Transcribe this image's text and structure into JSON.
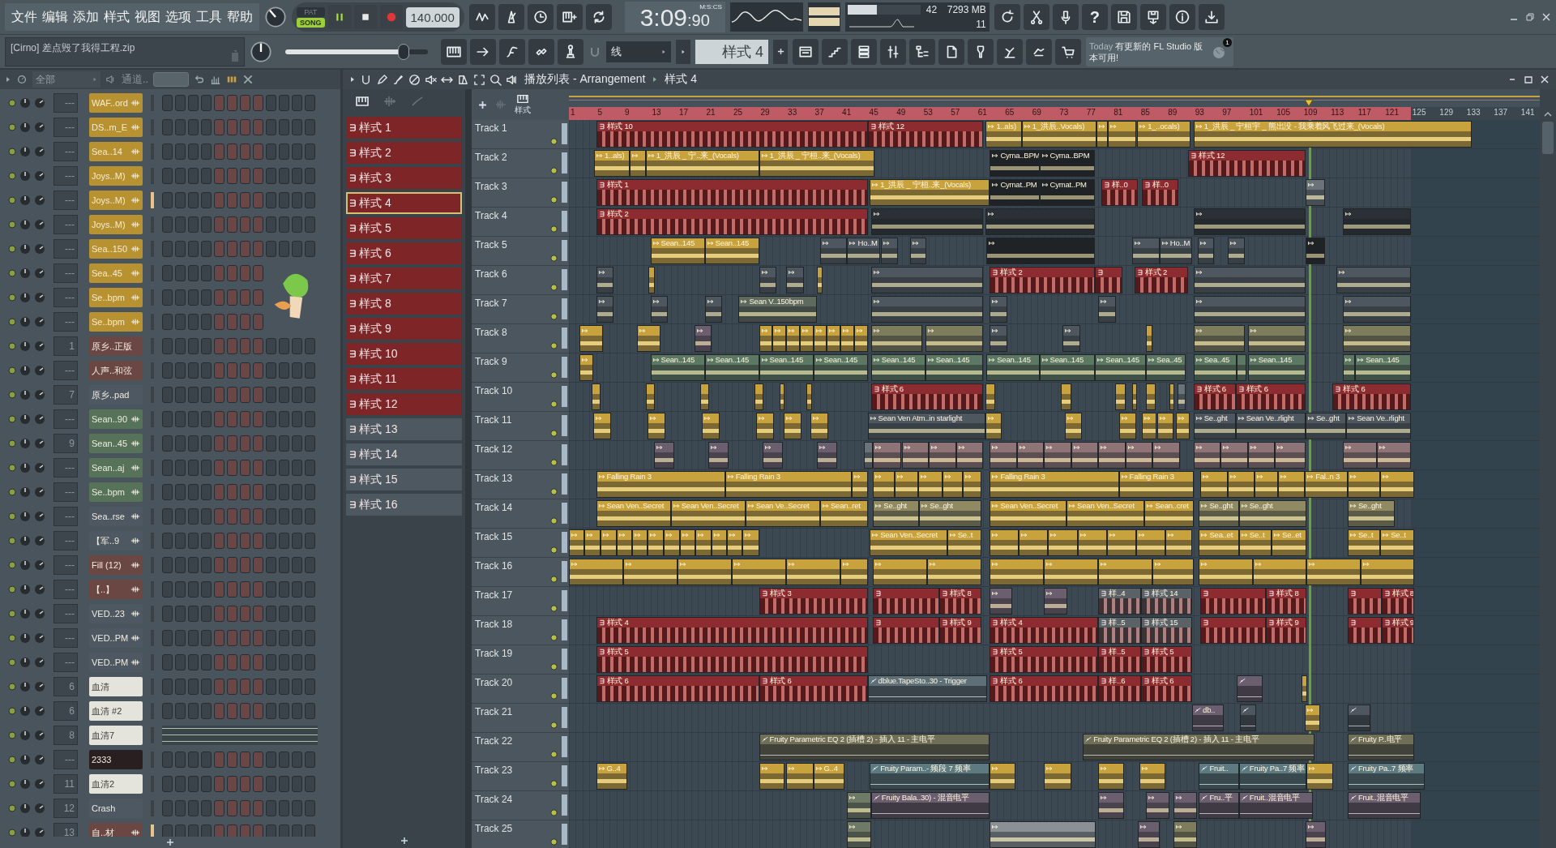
{
  "menu": [
    "文件",
    "编辑",
    "添加",
    "样式",
    "视图",
    "选项",
    "工具",
    "帮助"
  ],
  "transport": {
    "modes": [
      {
        "label": "PAT",
        "selected": false
      },
      {
        "label": "SONG",
        "selected": true
      }
    ],
    "playing": true,
    "tempo": "140.000",
    "time_main": "3:09",
    "time_cs": ":90",
    "time_format": "M:S:CS"
  },
  "monitor": {
    "level": 0.4,
    "cpu": "42",
    "memory": "7293 MB",
    "polyphony": "11"
  },
  "help": "?",
  "hint": "[Cirno] 差点毁了我得工程.zip",
  "master_slider": {
    "level": 0.83
  },
  "snap": "线",
  "pattern_selector": "样式 4",
  "news": {
    "day": "Today",
    "text": "有更新的 FL Studio 版本可用!",
    "badge": "1"
  },
  "channel_rack": {
    "filter": "全部",
    "title": "通道..",
    "channels": [
      {
        "name": "WAF..ord",
        "mixer": "---",
        "kind": "audio",
        "color": "#b89230",
        "selected": false
      },
      {
        "name": "DS..m_E",
        "mixer": "---",
        "kind": "audio",
        "color": "#b89230",
        "selected": false
      },
      {
        "name": "Sea..14",
        "mixer": "---",
        "kind": "audio",
        "color": "#b89230",
        "selected": false
      },
      {
        "name": "Joys..M)",
        "mixer": "---",
        "kind": "audio",
        "color": "#b89230",
        "selected": false
      },
      {
        "name": "Joys..M)",
        "mixer": "---",
        "kind": "audio",
        "color": "#b89230",
        "selected": true
      },
      {
        "name": "Joys..M)",
        "mixer": "---",
        "kind": "audio",
        "color": "#b89230",
        "selected": false
      },
      {
        "name": "Sea..150",
        "mixer": "---",
        "kind": "audio",
        "color": "#b89230",
        "selected": false
      },
      {
        "name": "Sea..45",
        "mixer": "---",
        "kind": "audio",
        "color": "#b89230",
        "selected": false
      },
      {
        "name": "Se..bpm",
        "mixer": "---",
        "kind": "audio",
        "color": "#b89230",
        "selected": false
      },
      {
        "name": "Se..bpm",
        "mixer": "---",
        "kind": "audio",
        "color": "#b89230",
        "selected": false
      },
      {
        "name": "原乡..正版",
        "mixer": "1",
        "kind": "instrument",
        "color": "#6b4744",
        "selected": false
      },
      {
        "name": "人声..和弦",
        "mixer": "---",
        "kind": "instrument",
        "color": "#6b4744",
        "selected": false
      },
      {
        "name": "原乡..pad",
        "mixer": "7",
        "kind": "instrument",
        "color": "#4d5862",
        "selected": false
      },
      {
        "name": "Sean..90",
        "mixer": "---",
        "kind": "audio",
        "color": "#56735a",
        "selected": false
      },
      {
        "name": "Sean..45",
        "mixer": "9",
        "kind": "audio",
        "color": "#56735a",
        "selected": false
      },
      {
        "name": "Sean..aj",
        "mixer": "---",
        "kind": "audio",
        "color": "#56735a",
        "selected": false
      },
      {
        "name": "Se..bpm",
        "mixer": "---",
        "kind": "audio",
        "color": "#56735a",
        "selected": false
      },
      {
        "name": "Sea..rse",
        "mixer": "---",
        "kind": "audio",
        "color": "#4d5862",
        "selected": false
      },
      {
        "name": "【军..9",
        "mixer": "---",
        "kind": "audio",
        "color": "#4d5862",
        "selected": false
      },
      {
        "name": "Fill (12)",
        "mixer": "---",
        "kind": "audio",
        "color": "#6b4744",
        "selected": false
      },
      {
        "name": "【..】",
        "mixer": "---",
        "kind": "audio",
        "color": "#6b4744",
        "selected": false
      },
      {
        "name": "VED..23",
        "mixer": "---",
        "kind": "audio",
        "color": "#4d5862",
        "selected": false
      },
      {
        "name": "VED..PM",
        "mixer": "---",
        "kind": "audio",
        "color": "#4d5862",
        "selected": false
      },
      {
        "name": "VED..PM",
        "mixer": "---",
        "kind": "audio",
        "color": "#4d5862",
        "selected": false
      },
      {
        "name": "血清",
        "mixer": "6",
        "kind": "instrument",
        "color": "#e4e4dc",
        "selected": false
      },
      {
        "name": "血清 #2",
        "mixer": "6",
        "kind": "instrument",
        "color": "#e4e4dc",
        "selected": false
      },
      {
        "name": "血清7",
        "mixer": "8",
        "kind": "pianoroll",
        "color": "#e4e4dc",
        "selected": false
      },
      {
        "name": "2333",
        "mixer": "---",
        "kind": "instrument",
        "color": "#2a1f20",
        "selected": false
      },
      {
        "name": "血清2",
        "mixer": "11",
        "kind": "instrument",
        "color": "#e4e4dc",
        "selected": false
      },
      {
        "name": "Crash",
        "mixer": "12",
        "kind": "instrument",
        "color": "#4d5862",
        "selected": false
      },
      {
        "name": "自..材",
        "mixer": "13",
        "kind": "audio",
        "color": "#6b4744",
        "selected": true
      }
    ]
  },
  "patterns": [
    {
      "name": "样式 1",
      "selected": false,
      "color": "#7e2528"
    },
    {
      "name": "样式 2",
      "selected": false,
      "color": "#7e2528"
    },
    {
      "name": "样式 3",
      "selected": false,
      "color": "#7e2528"
    },
    {
      "name": "样式 4",
      "selected": true,
      "color": "#7e2528"
    },
    {
      "name": "样式 5",
      "selected": false,
      "color": "#7e2528"
    },
    {
      "name": "样式 6",
      "selected": false,
      "color": "#7e2528"
    },
    {
      "name": "样式 7",
      "selected": false,
      "color": "#7e2528"
    },
    {
      "name": "样式 8",
      "selected": false,
      "color": "#7e2528"
    },
    {
      "name": "样式 9",
      "selected": false,
      "color": "#7e2528"
    },
    {
      "name": "样式 10",
      "selected": false,
      "color": "#7e2528"
    },
    {
      "name": "样式 11",
      "selected": false,
      "color": "#7e2528"
    },
    {
      "name": "样式 12",
      "selected": false,
      "color": "#7e2528"
    },
    {
      "name": "样式 13",
      "selected": false,
      "color": "#4e5860"
    },
    {
      "name": "样式 14",
      "selected": false,
      "color": "#4e5860"
    },
    {
      "name": "样式 15",
      "selected": false,
      "color": "#4e5860"
    },
    {
      "name": "样式 16",
      "selected": false,
      "color": "#4e5860"
    }
  ],
  "playlist": {
    "title": "播放列表 - Arrangement",
    "pattern": "样式 4",
    "tab": "样式",
    "ruler": [
      "1",
      "5",
      "9",
      "13",
      "17",
      "21",
      "25",
      "29",
      "33",
      "37",
      "41",
      "45",
      "49",
      "53",
      "57",
      "61",
      "65",
      "69",
      "73",
      "77",
      "81",
      "85",
      "89",
      "93",
      "97",
      "101",
      "105",
      "109",
      "113",
      "117",
      "121",
      "125",
      "129",
      "133",
      "137",
      "141"
    ],
    "tracks": [
      {
        "name": "Track 1",
        "clips": [
          {
            "kind": "pattern",
            "name": "样式 10",
            "color": "#8c2c30"
          },
          {
            "kind": "pattern",
            "name": "样式 12",
            "color": "#8c2c30"
          },
          {
            "kind": "audio",
            "name": "1..als)",
            "color": "#c8a23c"
          },
          {
            "kind": "audio",
            "name": "1_洪辰..Vocals)",
            "color": "#c8a23c"
          },
          {
            "kind": "audio",
            "color": "#c8a23c"
          },
          {
            "kind": "audio",
            "color": "#c8a23c"
          },
          {
            "kind": "audio",
            "name": "1_..ocals)",
            "color": "#c8a23c"
          },
          {
            "kind": "audio",
            "name": "1_洪辰 _ 宁桓宇 _ 熊出没 - 我乘着风飞过来_(Vocals)",
            "color": "#c8a23c"
          }
        ]
      },
      {
        "name": "Track 2",
        "clips": [
          {
            "kind": "audio",
            "name": "1..als)",
            "color": "#c8a23c"
          },
          {
            "kind": "audio",
            "color": "#c8a23c"
          },
          {
            "kind": "audio",
            "name": "1_洪辰 _ 宁..来_(Vocals)",
            "color": "#c8a23c"
          },
          {
            "kind": "audio",
            "name": "1_洪辰 _ 宁桓..来_(Vocals)",
            "color": "#c8a23c"
          },
          {
            "kind": "audio",
            "name": "Cyma..BPM",
            "color": "#1f2326"
          },
          {
            "kind": "audio",
            "name": "Cyma..BPM",
            "color": "#1f2326"
          },
          {
            "kind": "pattern",
            "name": "样式 12",
            "color": "#8c2c30"
          }
        ]
      },
      {
        "name": "Track 3",
        "clips": [
          {
            "kind": "pattern",
            "name": "样式 1",
            "color": "#8c2c30"
          },
          {
            "kind": "audio",
            "name": "1_洪辰 _ 宁桓..来_(Vocals)",
            "color": "#c8a23c"
          },
          {
            "kind": "audio",
            "name": "Cymat..PM",
            "color": "#1f2326"
          },
          {
            "kind": "audio",
            "name": "Cymat..PM",
            "color": "#1f2326"
          },
          {
            "kind": "pattern",
            "name": "样..0",
            "color": "#8c2c30"
          },
          {
            "kind": "pattern",
            "name": "样..0",
            "color": "#8c2c30"
          },
          {
            "kind": "audio",
            "color": "#6a737a"
          }
        ]
      },
      {
        "name": "Track 4",
        "clips": [
          {
            "kind": "pattern",
            "name": "样式 2",
            "color": "#8c2c30"
          },
          {
            "kind": "audio",
            "color": "#2a3036"
          },
          {
            "kind": "audio",
            "color": "#2a3036"
          },
          {
            "kind": "audio",
            "color": "#2a3036"
          },
          {
            "kind": "audio",
            "color": "#2a3036"
          }
        ]
      },
      {
        "name": "Track 5",
        "clips": [
          {
            "kind": "audio",
            "name": "Sean..145",
            "color": "#c8a23c"
          },
          {
            "kind": "audio",
            "name": "Sean..145",
            "color": "#c8a23c"
          },
          {
            "kind": "audio",
            "color": "#4e575f"
          },
          {
            "kind": "audio",
            "name": "Ho..M",
            "color": "#4e575f"
          },
          {
            "kind": "audio",
            "color": "#4e575f"
          },
          {
            "kind": "audio",
            "color": "#4e575f"
          },
          {
            "kind": "audio",
            "color": "#1f2326"
          },
          {
            "kind": "audio",
            "color": "#4e575f"
          },
          {
            "kind": "audio",
            "name": "Ho..M",
            "color": "#4e575f"
          },
          {
            "kind": "audio",
            "color": "#4e575f"
          },
          {
            "kind": "audio",
            "color": "#4e575f"
          },
          {
            "kind": "audio",
            "color": "#1f2326"
          }
        ]
      },
      {
        "name": "Track 6",
        "clips": [
          {
            "kind": "audio",
            "color": "#4e575f"
          },
          {
            "kind": "audio",
            "color": "#c8a23c"
          },
          {
            "kind": "audio",
            "color": "#4e575f"
          },
          {
            "kind": "audio",
            "color": "#4e575f"
          },
          {
            "kind": "audio",
            "color": "#c8a23c"
          },
          {
            "kind": "audio",
            "color": "#4e575f"
          },
          {
            "kind": "pattern",
            "name": "样式 2",
            "color": "#8c2c30"
          },
          {
            "kind": "pattern",
            "color": "#8c2c30"
          },
          {
            "kind": "pattern",
            "name": "样式 2",
            "color": "#8c2c30"
          },
          {
            "kind": "audio",
            "color": "#4e575f"
          },
          {
            "kind": "audio",
            "color": "#4e575f"
          }
        ]
      },
      {
        "name": "Track 7",
        "clips": [
          {
            "kind": "audio",
            "color": "#4e575f"
          },
          {
            "kind": "audio",
            "color": "#4e575f"
          },
          {
            "kind": "audio",
            "color": "#4e575f"
          },
          {
            "kind": "audio",
            "name": "Sean V..150bpm",
            "color": "#5f6a5e"
          },
          {
            "kind": "audio",
            "color": "#4e575f"
          },
          {
            "kind": "audio",
            "color": "#4e575f"
          },
          {
            "kind": "audio",
            "color": "#4e575f"
          },
          {
            "kind": "audio",
            "color": "#4e575f"
          },
          {
            "kind": "audio",
            "color": "#4e575f"
          }
        ]
      },
      {
        "name": "Track 8",
        "clips": [
          {
            "kind": "audio",
            "color": "#c8a23c"
          },
          {
            "kind": "audio",
            "color": "#c8a23c"
          },
          {
            "kind": "audio",
            "color": "#6b5e6e"
          },
          {
            "kind": "audio",
            "color": "#c8a23c"
          },
          {
            "kind": "audio",
            "color": "#c8a23c"
          },
          {
            "kind": "audio",
            "color": "#c8a23c"
          },
          {
            "kind": "audio",
            "color": "#c8a23c"
          },
          {
            "kind": "audio",
            "color": "#c8a23c"
          },
          {
            "kind": "audio",
            "color": "#c8a23c"
          },
          {
            "kind": "audio",
            "color": "#c8a23c"
          },
          {
            "kind": "audio",
            "color": "#c8a23c"
          },
          {
            "kind": "audio",
            "color": "#7d7c5c"
          },
          {
            "kind": "audio",
            "color": "#7d7c5c"
          },
          {
            "kind": "audio",
            "color": "#4e575f"
          },
          {
            "kind": "audio",
            "color": "#4e575f"
          },
          {
            "kind": "audio",
            "color": "#c8a23c"
          },
          {
            "kind": "audio",
            "color": "#7d7c5c"
          },
          {
            "kind": "audio",
            "color": "#7d7c5c"
          },
          {
            "kind": "audio",
            "color": "#7d7c5c"
          }
        ]
      },
      {
        "name": "Track 9",
        "clips": [
          {
            "kind": "audio",
            "color": "#c8a23c"
          },
          {
            "kind": "audio",
            "name": "Sean..145",
            "color": "#5c7862"
          },
          {
            "kind": "audio",
            "name": "Sean..145",
            "color": "#5c7862"
          },
          {
            "kind": "audio",
            "name": "Sean..145",
            "color": "#5c7862"
          },
          {
            "kind": "audio",
            "name": "Sean..145",
            "color": "#5c7862"
          },
          {
            "kind": "audio",
            "name": "Sean..145",
            "color": "#5c7862"
          },
          {
            "kind": "audio",
            "name": "Sean..145",
            "color": "#5c7862"
          },
          {
            "kind": "audio",
            "name": "Sean..145",
            "color": "#5c7862"
          },
          {
            "kind": "audio",
            "name": "Sean..145",
            "color": "#5c7862"
          },
          {
            "kind": "audio",
            "name": "Sean..145",
            "color": "#5c7862"
          },
          {
            "kind": "audio",
            "name": "Sea..45",
            "color": "#5c7862"
          },
          {
            "kind": "audio",
            "name": "Sea..45",
            "color": "#5c7862"
          },
          {
            "kind": "audio",
            "color": "#5c7862"
          },
          {
            "kind": "audio",
            "name": "Sean..145",
            "color": "#5c7862"
          },
          {
            "kind": "audio",
            "color": "#5c7862"
          },
          {
            "kind": "audio",
            "name": "Sean..145",
            "color": "#5c7862"
          }
        ]
      },
      {
        "name": "Track 10",
        "clips": [
          {
            "kind": "audio",
            "color": "#c8a23c"
          },
          {
            "kind": "audio",
            "color": "#c8a23c"
          },
          {
            "kind": "audio",
            "color": "#c8a23c"
          },
          {
            "kind": "audio",
            "color": "#c8a23c"
          },
          {
            "kind": "audio",
            "color": "#c8a23c"
          },
          {
            "kind": "audio",
            "color": "#c8a23c"
          },
          {
            "kind": "pattern",
            "name": "样式 6",
            "color": "#8c2c30"
          },
          {
            "kind": "audio",
            "color": "#c8a23c"
          },
          {
            "kind": "audio",
            "color": "#c8a23c"
          },
          {
            "kind": "audio",
            "color": "#c8a23c"
          },
          {
            "kind": "audio",
            "color": "#c8a23c"
          },
          {
            "kind": "audio",
            "color": "#c8a23c"
          },
          {
            "kind": "audio",
            "color": "#c8a23c"
          },
          {
            "kind": "audio",
            "color": "#6a737a"
          },
          {
            "kind": "pattern",
            "name": "样式 6",
            "color": "#8c2c30"
          },
          {
            "kind": "pattern",
            "name": "样式 6",
            "color": "#8c2c30"
          },
          {
            "kind": "pattern",
            "name": "样式 6",
            "color": "#8c2c30"
          }
        ]
      },
      {
        "name": "Track 11",
        "clips": [
          {
            "kind": "audio",
            "color": "#c8a23c"
          },
          {
            "kind": "audio",
            "color": "#c8a23c"
          },
          {
            "kind": "audio",
            "color": "#c8a23c"
          },
          {
            "kind": "audio",
            "color": "#c8a23c"
          },
          {
            "kind": "audio",
            "color": "#c8a23c"
          },
          {
            "kind": "audio",
            "color": "#c8a23c"
          },
          {
            "kind": "audio",
            "name": "Sean Ven Atm..in starlight",
            "color": "#4e575f"
          },
          {
            "kind": "audio",
            "color": "#c8a23c"
          },
          {
            "kind": "audio",
            "color": "#c8a23c"
          },
          {
            "kind": "audio",
            "color": "#c8a23c"
          },
          {
            "kind": "audio",
            "color": "#c8a23c"
          },
          {
            "kind": "audio",
            "color": "#c8a23c"
          },
          {
            "kind": "audio",
            "color": "#c8a23c"
          },
          {
            "kind": "audio",
            "name": "Se..ght",
            "color": "#4e575f"
          },
          {
            "kind": "audio",
            "name": "Sean Ve..rlight",
            "color": "#4e575f"
          },
          {
            "kind": "audio",
            "name": "Se..ght",
            "color": "#4e575f"
          },
          {
            "kind": "audio",
            "name": "Sean Ve..rlight",
            "color": "#4e575f"
          }
        ]
      },
      {
        "name": "Track 12",
        "clips": [
          {
            "kind": "audio",
            "color": "#6b5e6e"
          },
          {
            "kind": "audio",
            "color": "#6b5e6e"
          },
          {
            "kind": "audio",
            "color": "#6b5e6e"
          },
          {
            "kind": "audio",
            "color": "#6b5e6e"
          },
          {
            "kind": "audio",
            "color": "#6a737a"
          },
          {
            "kind": "audio",
            "color": "#8e7476"
          },
          {
            "kind": "audio",
            "color": "#8e7476"
          },
          {
            "kind": "audio",
            "color": "#8e7476"
          },
          {
            "kind": "audio",
            "color": "#8e7476"
          },
          {
            "kind": "audio",
            "color": "#8e7476"
          },
          {
            "kind": "audio",
            "color": "#8e7476"
          },
          {
            "kind": "audio",
            "color": "#8e7476"
          },
          {
            "kind": "audio",
            "color": "#8e7476"
          },
          {
            "kind": "audio",
            "color": "#8e7476"
          },
          {
            "kind": "audio",
            "color": "#8e7476"
          },
          {
            "kind": "audio",
            "color": "#8e7476"
          },
          {
            "kind": "audio",
            "color": "#8e7476"
          },
          {
            "kind": "audio",
            "color": "#8e7476"
          },
          {
            "kind": "audio",
            "color": "#8e7476"
          },
          {
            "kind": "audio",
            "color": "#8e7476"
          },
          {
            "kind": "audio",
            "color": "#8e7476"
          },
          {
            "kind": "audio",
            "color": "#8e7476"
          }
        ]
      },
      {
        "name": "Track 13",
        "clips": [
          {
            "kind": "audio",
            "name": "Falling Rain 3",
            "color": "#c8a23c"
          },
          {
            "kind": "audio",
            "name": "Falling Rain 3",
            "color": "#c8a23c"
          },
          {
            "kind": "audio",
            "color": "#c8a23c"
          },
          {
            "kind": "audio",
            "color": "#c8a23c"
          },
          {
            "kind": "audio",
            "color": "#c8a23c"
          },
          {
            "kind": "audio",
            "color": "#c8a23c"
          },
          {
            "kind": "audio",
            "color": "#c8a23c"
          },
          {
            "kind": "audio",
            "color": "#c8a23c"
          },
          {
            "kind": "audio",
            "name": "Falling Rain 3",
            "color": "#c8a23c"
          },
          {
            "kind": "audio",
            "name": "Falling Rain 3",
            "color": "#c8a23c"
          },
          {
            "kind": "audio",
            "color": "#c8a23c"
          },
          {
            "kind": "audio",
            "color": "#c8a23c"
          },
          {
            "kind": "audio",
            "color": "#c8a23c"
          },
          {
            "kind": "audio",
            "color": "#c8a23c"
          },
          {
            "kind": "audio",
            "name": "Fal..n 3",
            "color": "#c8a23c"
          },
          {
            "kind": "audio",
            "color": "#c8a23c"
          },
          {
            "kind": "audio",
            "color": "#c8a23c"
          }
        ]
      },
      {
        "name": "Track 14",
        "clips": [
          {
            "kind": "audio",
            "name": "Sean Ven..Secret",
            "color": "#c8a23c"
          },
          {
            "kind": "audio",
            "name": "Sean Ven..Secret",
            "color": "#c8a23c"
          },
          {
            "kind": "audio",
            "name": "Sean Ve..Secret",
            "color": "#c8a23c"
          },
          {
            "kind": "audio",
            "name": "Sean..ret",
            "color": "#c8a23c"
          },
          {
            "kind": "audio",
            "name": "Se..ght",
            "color": "#8f8a62"
          },
          {
            "kind": "audio",
            "name": "Se..ght",
            "color": "#8f8a62"
          },
          {
            "kind": "audio",
            "name": "Sean Ven..Secret",
            "color": "#c8a23c"
          },
          {
            "kind": "audio",
            "name": "Sean Ven..Secret",
            "color": "#c8a23c"
          },
          {
            "kind": "audio",
            "name": "Sean..cret",
            "color": "#c8a23c"
          },
          {
            "kind": "audio",
            "name": "Se..ght",
            "color": "#8f8a62"
          },
          {
            "kind": "audio",
            "name": "Se..ght",
            "color": "#8f8a62"
          },
          {
            "kind": "audio",
            "name": "Se..ght",
            "color": "#8f8a62"
          }
        ]
      },
      {
        "name": "Track 15",
        "clips": [
          {
            "kind": "audio",
            "color": "#c8a23c"
          },
          {
            "kind": "audio",
            "color": "#c8a23c"
          },
          {
            "kind": "audio",
            "color": "#c8a23c"
          },
          {
            "kind": "audio",
            "color": "#c8a23c"
          },
          {
            "kind": "audio",
            "color": "#c8a23c"
          },
          {
            "kind": "audio",
            "color": "#c8a23c"
          },
          {
            "kind": "audio",
            "color": "#c8a23c"
          },
          {
            "kind": "audio",
            "color": "#c8a23c"
          },
          {
            "kind": "audio",
            "color": "#c8a23c"
          },
          {
            "kind": "audio",
            "color": "#c8a23c"
          },
          {
            "kind": "audio",
            "color": "#c8a23c"
          },
          {
            "kind": "audio",
            "color": "#c8a23c"
          },
          {
            "kind": "audio",
            "name": "Sean Ven..Secret",
            "color": "#c8a23c"
          },
          {
            "kind": "audio",
            "name": "Se..t",
            "color": "#c8a23c"
          },
          {
            "kind": "audio",
            "color": "#c8a23c"
          },
          {
            "kind": "audio",
            "color": "#c8a23c"
          },
          {
            "kind": "audio",
            "color": "#c8a23c"
          },
          {
            "kind": "audio",
            "color": "#c8a23c"
          },
          {
            "kind": "audio",
            "color": "#c8a23c"
          },
          {
            "kind": "audio",
            "color": "#c8a23c"
          },
          {
            "kind": "audio",
            "color": "#c8a23c"
          },
          {
            "kind": "audio",
            "name": "Sea..et",
            "color": "#c8a23c"
          },
          {
            "kind": "audio",
            "name": "Se..t",
            "color": "#c8a23c"
          },
          {
            "kind": "audio",
            "name": "Se..et",
            "color": "#c8a23c"
          },
          {
            "kind": "audio",
            "name": "Se..t",
            "color": "#c8a23c"
          },
          {
            "kind": "audio",
            "name": "Se..t",
            "color": "#c8a23c"
          }
        ]
      },
      {
        "name": "Track 16",
        "clips": [
          {
            "kind": "audio",
            "color": "#c8a23c"
          },
          {
            "kind": "audio",
            "color": "#c8a23c"
          },
          {
            "kind": "audio",
            "color": "#c8a23c"
          },
          {
            "kind": "audio",
            "color": "#c8a23c"
          },
          {
            "kind": "audio",
            "color": "#c8a23c"
          },
          {
            "kind": "audio",
            "color": "#c8a23c"
          },
          {
            "kind": "audio",
            "color": "#c8a23c"
          },
          {
            "kind": "audio",
            "color": "#c8a23c"
          },
          {
            "kind": "audio",
            "color": "#c8a23c"
          },
          {
            "kind": "audio",
            "color": "#c8a23c"
          },
          {
            "kind": "audio",
            "color": "#c8a23c"
          },
          {
            "kind": "audio",
            "color": "#c8a23c"
          },
          {
            "kind": "audio",
            "color": "#c8a23c"
          },
          {
            "kind": "audio",
            "color": "#c8a23c"
          },
          {
            "kind": "audio",
            "color": "#c8a23c"
          },
          {
            "kind": "audio",
            "color": "#c8a23c"
          }
        ]
      },
      {
        "name": "Track 17",
        "clips": [
          {
            "kind": "pattern",
            "name": "样式 3",
            "color": "#8c2c30"
          },
          {
            "kind": "pattern",
            "color": "#8c2c30"
          },
          {
            "kind": "pattern",
            "name": "样式 8",
            "color": "#8c2c30"
          },
          {
            "kind": "audio",
            "color": "#6b5e6e"
          },
          {
            "kind": "audio",
            "color": "#6b5e6e"
          },
          {
            "kind": "pattern",
            "name": "样..4",
            "color": "#5a6268"
          },
          {
            "kind": "pattern",
            "name": "样式 14",
            "color": "#5a6268"
          },
          {
            "kind": "pattern",
            "color": "#8c2c30"
          },
          {
            "kind": "pattern",
            "name": "样式 8",
            "color": "#8c2c30"
          },
          {
            "kind": "pattern",
            "color": "#8c2c30"
          },
          {
            "kind": "pattern",
            "name": "样式 8",
            "color": "#8c2c30"
          }
        ]
      },
      {
        "name": "Track 18",
        "clips": [
          {
            "kind": "pattern",
            "name": "样式 4",
            "color": "#8c2c30"
          },
          {
            "kind": "pattern",
            "color": "#8c2c30"
          },
          {
            "kind": "pattern",
            "name": "样式 9",
            "color": "#8c2c30"
          },
          {
            "kind": "pattern",
            "name": "样式 4",
            "color": "#8c2c30"
          },
          {
            "kind": "pattern",
            "name": "样..5",
            "color": "#5a6268"
          },
          {
            "kind": "pattern",
            "name": "样式 15",
            "color": "#5a6268"
          },
          {
            "kind": "pattern",
            "color": "#8c2c30"
          },
          {
            "kind": "pattern",
            "name": "样式 9",
            "color": "#8c2c30"
          },
          {
            "kind": "pattern",
            "color": "#8c2c30"
          },
          {
            "kind": "pattern",
            "name": "样式 9",
            "color": "#8c2c30"
          }
        ]
      },
      {
        "name": "Track 19",
        "clips": [
          {
            "kind": "pattern",
            "name": "样式 5",
            "color": "#8c2c30"
          },
          {
            "kind": "pattern",
            "name": "样式 5",
            "color": "#8c2c30"
          },
          {
            "kind": "pattern",
            "name": "样..5",
            "color": "#8c2c30"
          },
          {
            "kind": "pattern",
            "name": "样式 5",
            "color": "#8c2c30"
          }
        ]
      },
      {
        "name": "Track 20",
        "clips": [
          {
            "kind": "pattern",
            "name": "样式 6",
            "color": "#8c2c30"
          },
          {
            "kind": "pattern",
            "name": "样式 6",
            "color": "#8c2c30"
          },
          {
            "kind": "automation",
            "name": "dblue.TapeSto..30 - Trigger",
            "color": "#5f6f78"
          },
          {
            "kind": "pattern",
            "name": "样式 6",
            "color": "#8c2c30"
          },
          {
            "kind": "pattern",
            "name": "样..6",
            "color": "#8c2c30"
          },
          {
            "kind": "pattern",
            "name": "样式 6",
            "color": "#8c2c30"
          },
          {
            "kind": "automation",
            "color": "#6b5e6e"
          },
          {
            "kind": "audio",
            "color": "#c8a23c"
          }
        ]
      },
      {
        "name": "Track 21",
        "clips": [
          {
            "kind": "automation",
            "name": "db..",
            "color": "#6b5e6e"
          },
          {
            "kind": "automation",
            "color": "#4e575f"
          },
          {
            "kind": "audio",
            "color": "#c8a23c"
          },
          {
            "kind": "automation",
            "color": "#4e575f"
          }
        ]
      },
      {
        "name": "Track 22",
        "clips": [
          {
            "kind": "automation",
            "name": "Fruity Parametric EQ 2 (插槽 2) - 插入 11 - 主电平",
            "color": "#6f6f58"
          },
          {
            "kind": "automation",
            "name": "Fruity Parametric EQ 2 (插槽 2) - 插入 11 - 主电平",
            "color": "#6f6f58"
          },
          {
            "kind": "automation",
            "name": "Fruity P..电平",
            "color": "#6f6f58"
          }
        ]
      },
      {
        "name": "Track 23",
        "clips": [
          {
            "kind": "audio",
            "name": "G..4",
            "color": "#c8a23c"
          },
          {
            "kind": "audio",
            "color": "#c8a23c"
          },
          {
            "kind": "audio",
            "color": "#c8a23c"
          },
          {
            "kind": "audio",
            "name": "G..4",
            "color": "#c8a23c"
          },
          {
            "kind": "automation",
            "name": "Fruity Param..- 频段 7 频率",
            "color": "#5d7a80"
          },
          {
            "kind": "audio",
            "color": "#c8a23c"
          },
          {
            "kind": "audio",
            "color": "#c8a23c"
          },
          {
            "kind": "audio",
            "color": "#c8a23c"
          },
          {
            "kind": "audio",
            "color": "#c8a23c"
          },
          {
            "kind": "automation",
            "name": "Fruit..",
            "color": "#5d7a80"
          },
          {
            "kind": "automation",
            "name": "Fruity Pa..7 频率",
            "color": "#5d7a80"
          },
          {
            "kind": "audio",
            "color": "#c8a23c"
          },
          {
            "kind": "automation",
            "name": "Fruity Pa..7 频率",
            "color": "#5d7a80"
          }
        ]
      },
      {
        "name": "Track 24",
        "clips": [
          {
            "kind": "audio",
            "color": "#6f7a66"
          },
          {
            "kind": "automation",
            "name": "Fruity Bala..30) - 混音电平",
            "color": "#6b5e6e"
          },
          {
            "kind": "audio",
            "color": "#6b5e6e"
          },
          {
            "kind": "audio",
            "color": "#6b5e6e"
          },
          {
            "kind": "audio",
            "color": "#6b5e6e"
          },
          {
            "kind": "automation",
            "name": "Fru..平",
            "color": "#6b5e6e"
          },
          {
            "kind": "automation",
            "name": "Fruit..混音电平",
            "color": "#6b5e6e"
          },
          {
            "kind": "automation",
            "name": "Fruit..混音电平",
            "color": "#6b5e6e"
          }
        ]
      },
      {
        "name": "Track 25",
        "clips": [
          {
            "kind": "audio",
            "color": "#6f7a66"
          },
          {
            "kind": "audio",
            "color": "#8a9096"
          },
          {
            "kind": "audio",
            "color": "#6b5e6e"
          },
          {
            "kind": "audio",
            "color": "#7d7c5c"
          },
          {
            "kind": "audio",
            "color": "#6b5e6e"
          }
        ]
      }
    ]
  }
}
